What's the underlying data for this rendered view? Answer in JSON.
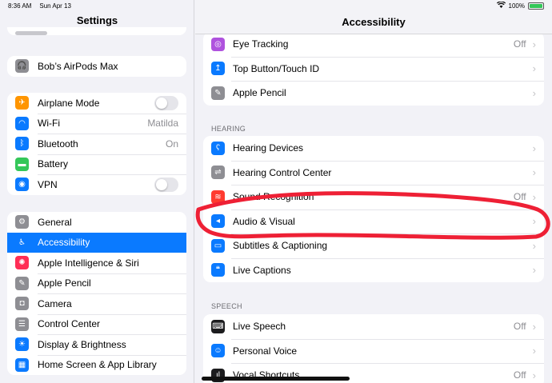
{
  "status": {
    "time": "8:36 AM",
    "date": "Sun Apr 13",
    "battery": "100%",
    "battery_level": 1.0
  },
  "sidebar": {
    "title": "Settings",
    "group1": [
      {
        "label": "Bob’s AirPods Max",
        "icon": "headphones-icon",
        "color": "#8e8e93"
      }
    ],
    "group2": [
      {
        "label": "Airplane Mode",
        "icon": "airplane-icon",
        "color": "#ff9500",
        "toggle": false
      },
      {
        "label": "Wi-Fi",
        "icon": "wifi-icon",
        "color": "#0a7aff",
        "value": "Matilda"
      },
      {
        "label": "Bluetooth",
        "icon": "bluetooth-icon",
        "color": "#0a7aff",
        "value": "On"
      },
      {
        "label": "Battery",
        "icon": "battery-icon",
        "color": "#34c759"
      },
      {
        "label": "VPN",
        "icon": "vpn-icon",
        "color": "#0a7aff",
        "toggle": false
      }
    ],
    "group3": [
      {
        "label": "General",
        "icon": "gear-icon",
        "color": "#8e8e93"
      },
      {
        "label": "Accessibility",
        "icon": "accessibility-icon",
        "color": "#0a7aff",
        "selected": true
      },
      {
        "label": "Apple Intelligence & Siri",
        "icon": "siri-icon",
        "color": "#ff2d55"
      },
      {
        "label": "Apple Pencil",
        "icon": "pencil-icon",
        "color": "#8e8e93"
      },
      {
        "label": "Camera",
        "icon": "camera-icon",
        "color": "#8e8e93"
      },
      {
        "label": "Control Center",
        "icon": "control-center-icon",
        "color": "#8e8e93"
      },
      {
        "label": "Display & Brightness",
        "icon": "sun-icon",
        "color": "#0a7aff"
      },
      {
        "label": "Home Screen & App Library",
        "icon": "home-screen-icon",
        "color": "#0a7aff"
      }
    ]
  },
  "main": {
    "title": "Accessibility",
    "group_top": [
      {
        "label": "Eye Tracking",
        "icon": "eye-tracking-icon",
        "color": "#af52de",
        "value": "Off"
      },
      {
        "label": "Top Button/Touch ID",
        "icon": "top-button-icon",
        "color": "#0a7aff"
      },
      {
        "label": "Apple Pencil",
        "icon": "pencil-icon",
        "color": "#8e8e93"
      }
    ],
    "hearing_label": "HEARING",
    "hearing": [
      {
        "label": "Hearing Devices",
        "icon": "ear-icon",
        "color": "#0a7aff"
      },
      {
        "label": "Hearing Control Center",
        "icon": "toggles-icon",
        "color": "#8e8e93"
      },
      {
        "label": "Sound Recognition",
        "icon": "sound-wave-icon",
        "color": "#ff3b30",
        "value": "Off"
      },
      {
        "label": "Audio & Visual",
        "icon": "speaker-eye-icon",
        "color": "#0a7aff"
      },
      {
        "label": "Subtitles & Captioning",
        "icon": "captions-icon",
        "color": "#0a7aff"
      },
      {
        "label": "Live Captions",
        "icon": "live-captions-icon",
        "color": "#0a7aff"
      }
    ],
    "speech_label": "SPEECH",
    "speech": [
      {
        "label": "Live Speech",
        "icon": "keyboard-icon",
        "color": "#1c1c1e",
        "value": "Off"
      },
      {
        "label": "Personal Voice",
        "icon": "person-voice-icon",
        "color": "#0a7aff"
      },
      {
        "label": "Vocal Shortcuts",
        "icon": "waveform-icon",
        "color": "#1c1c1e",
        "value": "Off"
      }
    ]
  }
}
